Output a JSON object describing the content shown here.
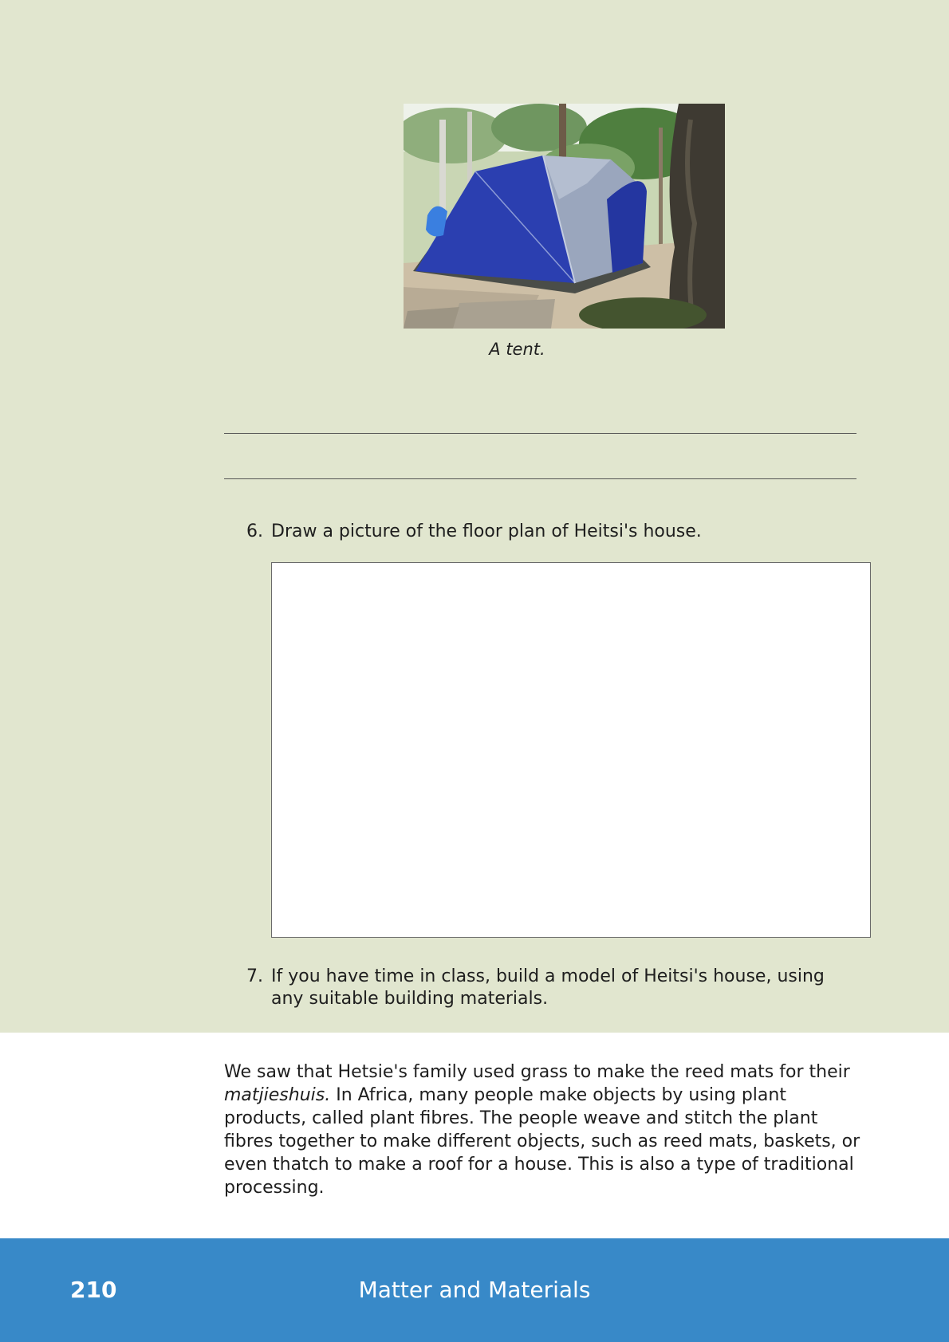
{
  "figure": {
    "image_alt": "A blue and grey dome tent pitched on sandy ground among trees",
    "caption": "A tent."
  },
  "questions": [
    {
      "number": "6.",
      "text": "Draw a picture of the floor plan of Heitsi's house."
    },
    {
      "number": "7.",
      "text": "If you have time in class, build a model of Heitsi's house, using any suitable building materials."
    }
  ],
  "paragraph": {
    "part1": "We saw that Hetsie's family used grass to make the reed mats for their ",
    "emphasis": "matjieshuis.",
    "part2": " In Africa, many people make objects by using plant products, called plant fibres. The people weave and stitch the plant fibres together to make different objects, such as reed mats, baskets, or even thatch to make a roof for a house. This is also a type of traditional processing."
  },
  "footer": {
    "page_number": "210",
    "title": "Matter and Materials"
  },
  "colors": {
    "panel_background": "#e1e6cf",
    "footer_background": "#3889c8",
    "tent_blue": "#2b3fb0"
  }
}
